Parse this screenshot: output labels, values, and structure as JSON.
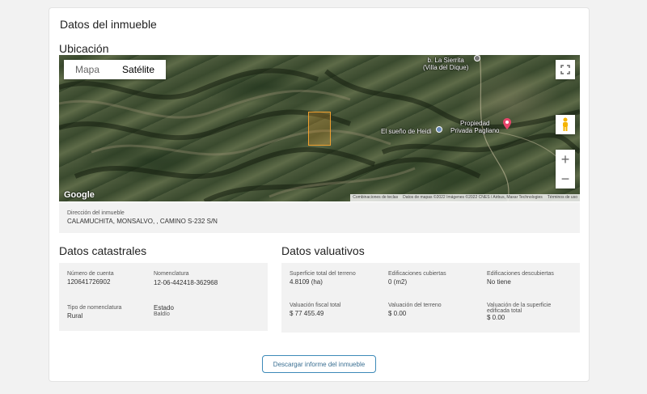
{
  "card": {
    "title": "Datos del inmueble"
  },
  "location": {
    "title": "Ubicación",
    "map_types": {
      "map": "Mapa",
      "satellite": "Satélite"
    },
    "labels": {
      "dique": "b. La Sierrita\n(Villa del Dique)",
      "dique_line1": "b. La Sierrita",
      "dique_line2": "(Villa del Dique)",
      "heidi": "El sueño de Heidi",
      "pagliano_line1": "Propiedad",
      "pagliano_line2": "Privada Pagliano"
    },
    "google": "Google",
    "attribution": {
      "shortcuts": "Combinaciones de teclas",
      "data": "Datos de mapas ©2022 Imágenes ©2022 CNES / Airbus, Maxar Technologies",
      "terms": "Términos de uso"
    },
    "icons": {
      "fullscreen": "fullscreen-icon",
      "pegman": "pegman-icon",
      "zoom_in": "plus-icon",
      "zoom_out": "minus-icon"
    },
    "address_label": "Dirección del inmueble",
    "address_value": "CALAMUCHITA, MONSALVO, , CAMINO S-232 S/N"
  },
  "cadastral": {
    "title": "Datos catastrales",
    "account_label": "Número de cuenta",
    "account_value": "120641726902",
    "nomenclature_label": "Nomenclatura",
    "nomenclature_value": "12-06-442418-362968",
    "nomenclature_type_label": "Tipo de nomenclatura",
    "nomenclature_type_value": "Rural",
    "state_label": "Estado",
    "state_value": "Baldío"
  },
  "valuation": {
    "title": "Datos valuativos",
    "land_area_label": "Superficie total del terreno",
    "land_area_value": "4.8109 (ha)",
    "covered_label": "Edificaciones cubiertas",
    "covered_value": "0 (m2)",
    "uncovered_label": "Edificaciones descubiertas",
    "uncovered_value": "No tiene",
    "fiscal_label": "Valuación fiscal total",
    "fiscal_value": "$ 77 455.49",
    "land_value_label": "Valuación del terreno",
    "land_value_value": "$ 0.00",
    "built_label_line1": "Valuación de la superficie",
    "built_label_line2": "edificada total",
    "built_value": "$ 0.00"
  },
  "download_button": "Descargar informe del inmueble",
  "colors": {
    "accent": "#3d8ab8",
    "parcel": "#f0a030",
    "pin": "#e8456b"
  }
}
